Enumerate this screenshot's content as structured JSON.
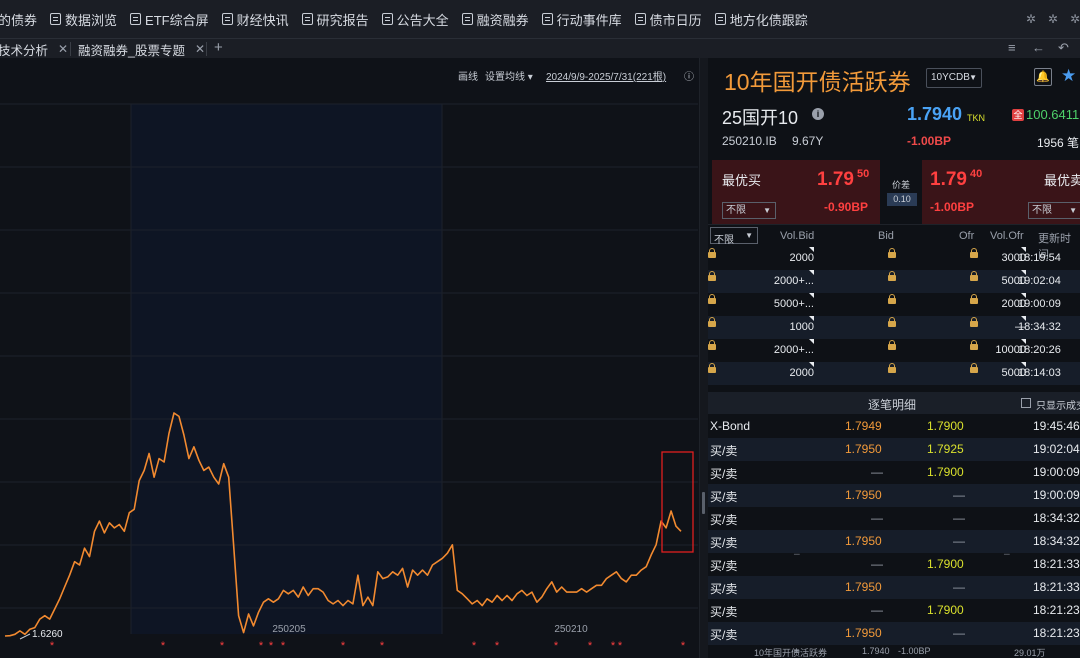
{
  "menu": {
    "items": [
      {
        "label": "的债券",
        "icon": null
      },
      {
        "label": "数据浏览",
        "icon": "table-icon"
      },
      {
        "label": "ETF综合屏",
        "icon": "chart-icon"
      },
      {
        "label": "财经快讯",
        "icon": "document-icon"
      },
      {
        "label": "研究报告",
        "icon": "document-icon"
      },
      {
        "label": "公告大全",
        "icon": "document-icon"
      },
      {
        "label": "融资融券",
        "icon": "chart-icon"
      },
      {
        "label": "行动事件库",
        "icon": "document-icon"
      },
      {
        "label": "债市日历",
        "icon": "calendar-icon"
      },
      {
        "label": "地方化债跟踪",
        "icon": "document-icon"
      }
    ],
    "right_icons": [
      "gear-icon",
      "gear-icon",
      "gear-icon"
    ]
  },
  "tabs": [
    {
      "label": "技术分析"
    },
    {
      "label": "融资融券_股票专题"
    }
  ],
  "tabbar_icons": {
    "add": "+",
    "menu": "≡",
    "back": "←",
    "undo": "↶"
  },
  "chart_toolbar": {
    "draw": "画线",
    "ma_setting": "设置均线",
    "range": "2024/9/9-2025/7/31(221根)"
  },
  "chart_data": {
    "type": "line",
    "series": [
      {
        "values": [
          1.626,
          1.6262,
          1.627,
          1.629,
          1.627,
          1.63,
          1.631,
          1.636,
          1.638,
          1.636,
          1.642,
          1.648,
          1.655,
          1.662,
          1.67,
          1.668,
          1.678,
          1.673,
          1.688,
          1.694,
          1.687,
          1.693,
          1.69,
          1.692,
          1.688,
          1.699,
          1.701,
          1.718,
          1.724,
          1.734,
          1.72,
          1.731,
          1.729,
          1.746,
          1.758,
          1.756,
          1.745,
          1.731,
          1.738,
          1.73,
          1.724,
          1.726,
          1.72,
          1.716,
          1.728,
          1.72,
          1.68,
          1.638,
          1.628,
          1.639,
          1.632,
          1.64,
          1.646,
          1.648,
          1.646,
          1.648,
          1.653,
          1.651,
          1.653,
          1.649,
          1.655,
          1.65,
          1.654,
          1.654,
          1.652,
          1.647,
          1.645,
          1.647,
          1.644,
          1.647,
          1.645,
          1.662,
          1.644,
          1.649,
          1.644,
          1.664,
          1.66,
          1.661,
          1.664,
          1.662,
          1.666,
          1.655,
          1.665,
          1.662,
          1.665,
          1.662,
          1.668,
          1.67,
          1.672,
          1.675,
          1.68,
          1.653,
          1.651,
          1.648,
          1.645,
          1.647,
          1.644,
          1.648,
          1.646,
          1.65,
          1.647,
          1.65,
          1.647,
          1.651,
          1.653,
          1.65,
          1.652,
          1.646,
          1.649,
          1.654,
          1.658,
          1.652,
          1.655,
          1.652,
          1.652,
          1.652,
          1.654,
          1.652,
          1.654,
          1.656,
          1.656,
          1.66,
          1.662,
          1.664,
          1.66,
          1.658,
          1.662,
          1.662,
          1.665,
          1.667,
          1.674,
          1.68,
          1.694,
          1.69,
          1.7,
          1.691,
          1.688
        ]
      }
    ],
    "x_ticks": [
      "250205",
      "250210"
    ],
    "min_label": "1.6260",
    "event_marker": "*"
  },
  "bond": {
    "title": "10年国开债活跃券",
    "curve_select": "10YCDB",
    "short_name": "25国开10",
    "last_yield": "1.7940",
    "yield_source": "TKN",
    "price_badge": "全",
    "clean_price": "100.6411",
    "code": "250210.IB",
    "term": "9.67Y",
    "change_bp": "-1.00BP",
    "trade_count": "1956 笔"
  },
  "best_quote": {
    "bid_label": "最优买",
    "bid_price_main": "1.79",
    "bid_price_sup": "50",
    "bid_bp": "-0.90BP",
    "spread_label": "价差",
    "spread_value": "0.10",
    "ofr_price_main": "1.79",
    "ofr_price_sup": "40",
    "ofr_bp": "-1.00BP",
    "ofr_label": "最优卖",
    "limit_option": "不限"
  },
  "depth": {
    "limit_option": "不限",
    "headers": [
      "Vol.Bid",
      "Bid",
      "Ofr",
      "Vol.Ofr",
      "更新时间"
    ],
    "rows": [
      {
        "vol_bid": "2000",
        "vol_ofr": "3000",
        "time": "18:19:54"
      },
      {
        "vol_bid": "2000+...",
        "vol_ofr": "5000",
        "time": "19:02:04"
      },
      {
        "vol_bid": "5000+...",
        "vol_ofr": "2000",
        "time": "19:00:09"
      },
      {
        "vol_bid": "1000",
        "vol_ofr": "—",
        "time": "18:34:32"
      },
      {
        "vol_bid": "2000+...",
        "vol_ofr": "10000",
        "time": "18:20:26"
      },
      {
        "vol_bid": "2000",
        "vol_ofr": "5000",
        "time": "18:14:03"
      }
    ]
  },
  "trades": {
    "title": "逐笔明细",
    "filter_label": "只显示成交",
    "rows": [
      {
        "kind": "X-Bond",
        "bid": "1.7949",
        "ofr": "1.7900",
        "time": "19:45:46"
      },
      {
        "kind": "买/卖",
        "bid": "1.7950",
        "ofr": "1.7925",
        "time": "19:02:04"
      },
      {
        "kind": "买/卖",
        "bid": "—",
        "ofr": "1.7900",
        "time": "19:00:09"
      },
      {
        "kind": "买/卖",
        "bid": "1.7950",
        "ofr": "—",
        "time": "19:00:09"
      },
      {
        "kind": "买/卖",
        "bid": "—",
        "ofr": "—",
        "time": "18:34:32"
      },
      {
        "kind": "买/卖",
        "bid": "1.7950",
        "ofr": "—",
        "time": "18:34:32"
      },
      {
        "kind": "买/卖",
        "bid": "—",
        "ofr": "1.7900",
        "time": "18:21:33"
      },
      {
        "kind": "买/卖",
        "bid": "1.7950",
        "ofr": "—",
        "time": "18:21:33"
      },
      {
        "kind": "买/卖",
        "bid": "—",
        "ofr": "1.7900",
        "time": "18:21:23"
      },
      {
        "kind": "买/卖",
        "bid": "1.7950",
        "ofr": "—",
        "time": "18:21:23"
      }
    ],
    "footer": {
      "name": "10年国开债活跃券",
      "yield": "1.7940",
      "bp": "-1.00BP",
      "amount": "29.01万"
    }
  },
  "colors": {
    "line": "#f28a30",
    "up": "#ff4040",
    "yield": "#4aa3f5",
    "bid": "#f29a3a",
    "ofr": "#d9e02d",
    "highlight_box": "#e02020"
  }
}
